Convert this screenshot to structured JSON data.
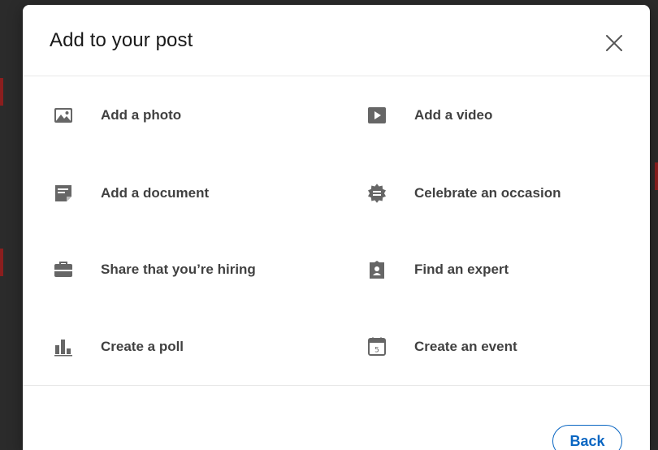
{
  "dialog": {
    "title": "Add to your post",
    "close_icon": "close-icon",
    "back_label": "Back",
    "accent_color": "#0a66c2"
  },
  "options": [
    {
      "label": "Add a photo",
      "icon": "photo-icon"
    },
    {
      "label": "Add a video",
      "icon": "video-icon"
    },
    {
      "label": "Add a document",
      "icon": "document-icon"
    },
    {
      "label": "Celebrate an occasion",
      "icon": "celebrate-icon"
    },
    {
      "label": "Share that you’re hiring",
      "icon": "briefcase-icon"
    },
    {
      "label": "Find an expert",
      "icon": "expert-badge-icon"
    },
    {
      "label": "Create a poll",
      "icon": "poll-icon"
    },
    {
      "label": "Create an event",
      "icon": "calendar-icon"
    }
  ],
  "calendar_icon_day": "5"
}
